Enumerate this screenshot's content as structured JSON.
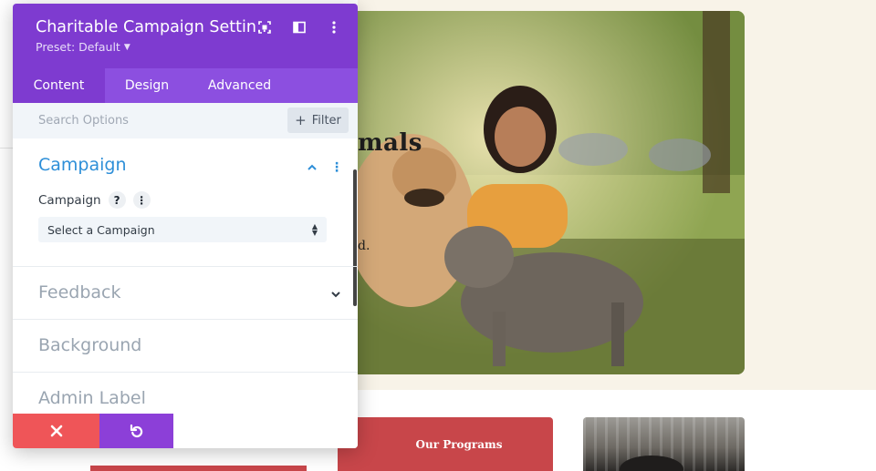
{
  "background_page": {
    "hero_heading_fragment": "mals",
    "hero_text_fragment": "d.",
    "program_card_label": "Our Programs"
  },
  "modal": {
    "title": "Charitable Campaign Settin…",
    "preset_label": "Preset: Default",
    "header_icons": [
      "expand-icon",
      "sidebar-toggle-icon",
      "more-options-icon"
    ],
    "tabs": [
      {
        "label": "Content",
        "active": true
      },
      {
        "label": "Design",
        "active": false
      },
      {
        "label": "Advanced",
        "active": false
      }
    ],
    "search": {
      "placeholder": "Search Options",
      "value": ""
    },
    "filter_label": "Filter",
    "sections": {
      "campaign": {
        "title": "Campaign",
        "expanded": true,
        "field_label": "Campaign",
        "help_symbol": "?",
        "select_value": "Select a Campaign"
      },
      "feedback": {
        "title": "Feedback",
        "expanded": false
      },
      "background": {
        "title": "Background"
      },
      "admin_label": {
        "title": "Admin Label"
      }
    },
    "footer": {
      "cancel_icon": "close-icon",
      "undo_icon": "undo-icon"
    }
  },
  "colors": {
    "header_purple": "#7e3bd0",
    "tab_bar_purple": "#8c4fe0",
    "section_blue": "#2e8fd8",
    "cancel_red": "#ef5558",
    "undo_purple": "#8c3fd8",
    "program_red": "#c8464a",
    "cream": "#f8f3e8"
  }
}
